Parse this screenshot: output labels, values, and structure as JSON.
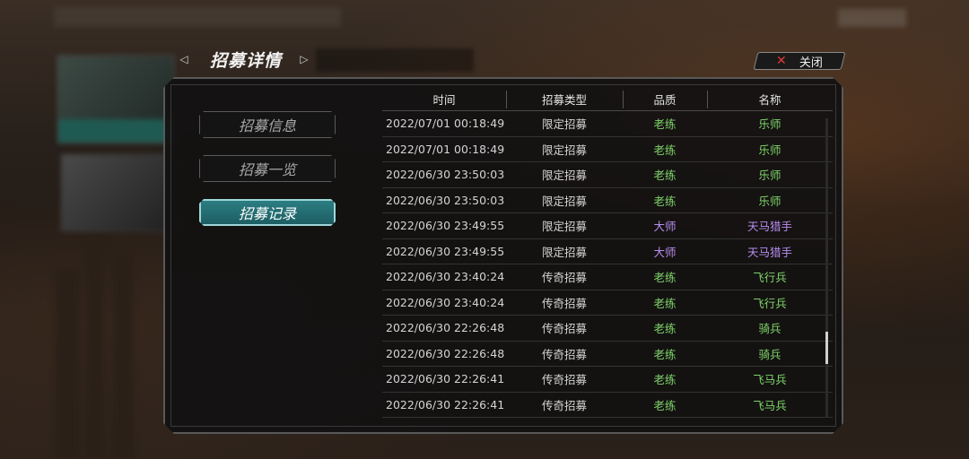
{
  "header": {
    "title": "招募详情",
    "prev_arrow": "◁",
    "next_arrow": "▷",
    "close_label": "关闭",
    "close_icon": "✕"
  },
  "tabs": [
    {
      "label": "招募信息",
      "active": false
    },
    {
      "label": "招募一览",
      "active": false
    },
    {
      "label": "招募记录",
      "active": true
    }
  ],
  "table": {
    "columns": [
      "时间",
      "招募类型",
      "品质",
      "名称"
    ],
    "rows": [
      {
        "time": "2022/07/01  00:18:49",
        "type": "限定招募",
        "quality": "老练",
        "name": "乐师"
      },
      {
        "time": "2022/07/01  00:18:49",
        "type": "限定招募",
        "quality": "老练",
        "name": "乐师"
      },
      {
        "time": "2022/06/30  23:50:03",
        "type": "限定招募",
        "quality": "老练",
        "name": "乐师"
      },
      {
        "time": "2022/06/30  23:50:03",
        "type": "限定招募",
        "quality": "老练",
        "name": "乐师"
      },
      {
        "time": "2022/06/30  23:49:55",
        "type": "限定招募",
        "quality": "大师",
        "name": "天马猎手"
      },
      {
        "time": "2022/06/30  23:49:55",
        "type": "限定招募",
        "quality": "大师",
        "name": "天马猎手"
      },
      {
        "time": "2022/06/30  23:40:24",
        "type": "传奇招募",
        "quality": "老练",
        "name": "飞行兵"
      },
      {
        "time": "2022/06/30  23:40:24",
        "type": "传奇招募",
        "quality": "老练",
        "name": "飞行兵"
      },
      {
        "time": "2022/06/30  22:26:48",
        "type": "传奇招募",
        "quality": "老练",
        "name": "骑兵"
      },
      {
        "time": "2022/06/30  22:26:48",
        "type": "传奇招募",
        "quality": "老练",
        "name": "骑兵"
      },
      {
        "time": "2022/06/30  22:26:41",
        "type": "传奇招募",
        "quality": "老练",
        "name": "飞马兵"
      },
      {
        "time": "2022/06/30  22:26:41",
        "type": "传奇招募",
        "quality": "老练",
        "name": "飞马兵"
      }
    ]
  },
  "quality_colors": {
    "老练": "#7fd46a",
    "大师": "#b88df0"
  },
  "scroll_position": 0.8,
  "colors": {
    "accent": "#2b7d82",
    "close_x": "#e03a3a"
  }
}
